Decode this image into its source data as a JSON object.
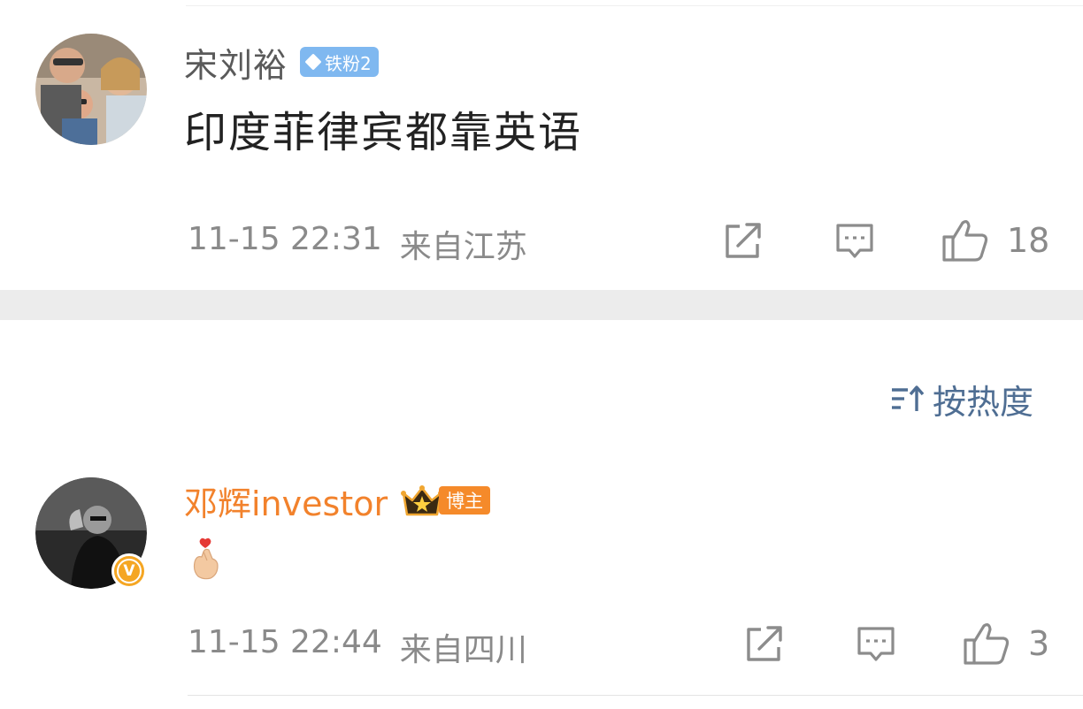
{
  "comments": [
    {
      "username": "宋刘裕",
      "badge_label": "铁粉2",
      "text": "印度菲律宾都靠英语",
      "timestamp": "11-15 22:31",
      "location": "来自江苏",
      "like_count": "18"
    },
    {
      "username": "邓辉investor",
      "badge_label": "博主",
      "verified_symbol": "V",
      "emoji_name": "finger-heart-emoji",
      "timestamp": "11-15 22:44",
      "location": "来自四川",
      "like_count": "3"
    }
  ],
  "sort": {
    "label": "按热度"
  },
  "icons": {
    "share": "share-icon",
    "reply": "comment-icon",
    "like": "thumbs-up-icon",
    "sort": "sort-icon"
  },
  "colors": {
    "username_orange": "#f2822c",
    "sort_blue": "#4f6e93",
    "fan_badge_blue": "#7fb8f0",
    "verified_gold": "#f5a623"
  }
}
